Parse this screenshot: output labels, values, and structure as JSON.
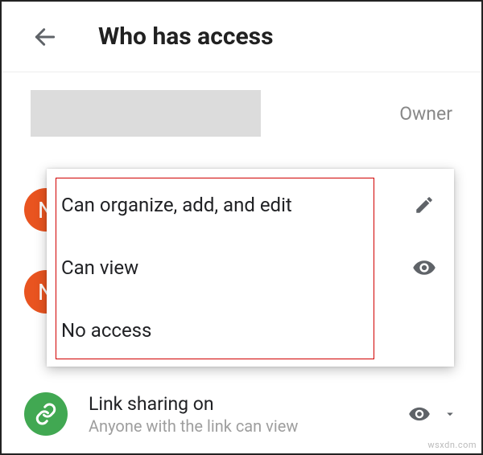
{
  "header": {
    "title": "Who has access"
  },
  "owner": {
    "role_label": "Owner"
  },
  "avatars": [
    {
      "initial": "N"
    },
    {
      "initial": "N"
    }
  ],
  "permissions_menu": [
    {
      "label": "Can organize, add, and edit",
      "icon": "pencil-icon"
    },
    {
      "label": "Can view",
      "icon": "eye-icon"
    },
    {
      "label": "No access",
      "icon": ""
    }
  ],
  "link_sharing": {
    "title": "Link sharing on",
    "subtitle": "Anyone with the link can view"
  },
  "watermark": "wsxdn.com"
}
